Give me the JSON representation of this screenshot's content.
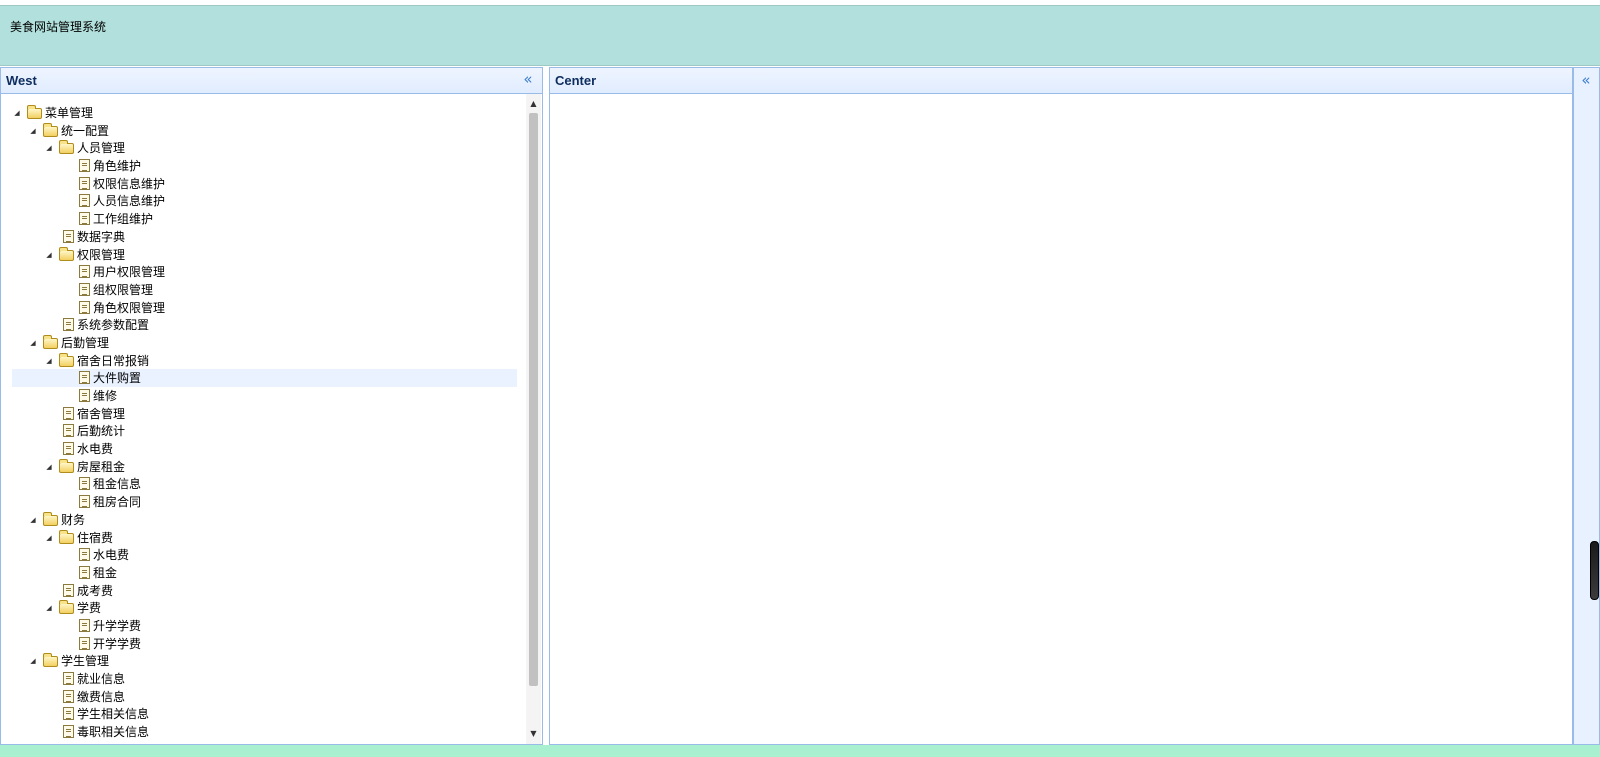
{
  "header": {
    "title": "美食网站管理系统"
  },
  "west": {
    "title": "West",
    "collapse_icon": "double-chevron-left-icon"
  },
  "center": {
    "title": "Center",
    "collapse_icon": "double-chevron-left-icon"
  },
  "east": {
    "collapse_icon": "double-chevron-left-icon"
  },
  "colors": {
    "north_bg": "#b2e0dc",
    "panel_border": "#99bbe8",
    "bottom_bar": "#a9f0d1",
    "selected_row": "#eaf2ff"
  },
  "tree": [
    {
      "label": "菜单管理",
      "depth": 0,
      "type": "folder",
      "expanded": true
    },
    {
      "label": "统一配置",
      "depth": 1,
      "type": "folder",
      "expanded": true
    },
    {
      "label": "人员管理",
      "depth": 2,
      "type": "folder",
      "expanded": true
    },
    {
      "label": "角色维护",
      "depth": 3,
      "type": "file"
    },
    {
      "label": "权限信息维护",
      "depth": 3,
      "type": "file"
    },
    {
      "label": "人员信息维护",
      "depth": 3,
      "type": "file"
    },
    {
      "label": "工作组维护",
      "depth": 3,
      "type": "file"
    },
    {
      "label": "数据字典",
      "depth": 2,
      "type": "file"
    },
    {
      "label": "权限管理",
      "depth": 2,
      "type": "folder",
      "expanded": true
    },
    {
      "label": "用户权限管理",
      "depth": 3,
      "type": "file"
    },
    {
      "label": "组权限管理",
      "depth": 3,
      "type": "file"
    },
    {
      "label": "角色权限管理",
      "depth": 3,
      "type": "file"
    },
    {
      "label": "系统参数配置",
      "depth": 2,
      "type": "file"
    },
    {
      "label": "后勤管理",
      "depth": 1,
      "type": "folder",
      "expanded": true
    },
    {
      "label": "宿舍日常报销",
      "depth": 2,
      "type": "folder",
      "expanded": true
    },
    {
      "label": "大件购置",
      "depth": 3,
      "type": "file",
      "selected": true
    },
    {
      "label": "维修",
      "depth": 3,
      "type": "file"
    },
    {
      "label": "宿舍管理",
      "depth": 2,
      "type": "file"
    },
    {
      "label": "后勤统计",
      "depth": 2,
      "type": "file"
    },
    {
      "label": "水电费",
      "depth": 2,
      "type": "file"
    },
    {
      "label": "房屋租金",
      "depth": 2,
      "type": "folder",
      "expanded": true
    },
    {
      "label": "租金信息",
      "depth": 3,
      "type": "file"
    },
    {
      "label": "租房合同",
      "depth": 3,
      "type": "file"
    },
    {
      "label": "财务",
      "depth": 1,
      "type": "folder",
      "expanded": true
    },
    {
      "label": "住宿费",
      "depth": 2,
      "type": "folder",
      "expanded": true
    },
    {
      "label": "水电费",
      "depth": 3,
      "type": "file"
    },
    {
      "label": "租金",
      "depth": 3,
      "type": "file"
    },
    {
      "label": "成考费",
      "depth": 2,
      "type": "file"
    },
    {
      "label": "学费",
      "depth": 2,
      "type": "folder",
      "expanded": true
    },
    {
      "label": "升学学费",
      "depth": 3,
      "type": "file"
    },
    {
      "label": "开学学费",
      "depth": 3,
      "type": "file"
    },
    {
      "label": "学生管理",
      "depth": 1,
      "type": "folder",
      "expanded": true
    },
    {
      "label": "就业信息",
      "depth": 2,
      "type": "file"
    },
    {
      "label": "缴费信息",
      "depth": 2,
      "type": "file"
    },
    {
      "label": "学生相关信息",
      "depth": 2,
      "type": "file"
    },
    {
      "label": "毒职相关信息",
      "depth": 2,
      "type": "file"
    }
  ]
}
